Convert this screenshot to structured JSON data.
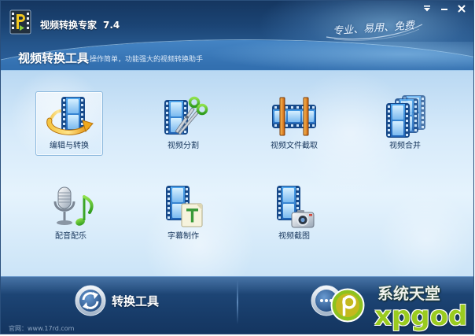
{
  "window": {
    "title": "视频转换专家",
    "version": "7.4",
    "slogan": "专业、易用、免费",
    "app_icon": "app-logo-icon",
    "controls": [
      {
        "name": "menu-dropdown-icon"
      },
      {
        "name": "minimize-icon"
      },
      {
        "name": "close-icon"
      }
    ]
  },
  "header": {
    "section_title": "视频转换工具",
    "section_subtitle": "操作简单，功能强大的视频转换助手"
  },
  "tools": [
    {
      "label": "编辑与转换",
      "icon": "film-convert-icon",
      "selected": true
    },
    {
      "label": "视频分割",
      "icon": "film-scissors-icon",
      "selected": false
    },
    {
      "label": "视频文件截取",
      "icon": "film-trim-icon",
      "selected": false
    },
    {
      "label": "视频合并",
      "icon": "film-merge-icon",
      "selected": false
    },
    {
      "label": "配音配乐",
      "icon": "microphone-music-icon",
      "selected": false
    },
    {
      "label": "字幕制作",
      "icon": "film-subtitle-icon",
      "selected": false
    },
    {
      "label": "视频截图",
      "icon": "film-camera-icon",
      "selected": false
    }
  ],
  "bottom_bar": {
    "convert_tab": {
      "label": "转换工具",
      "icon": "convert-arrows-icon"
    },
    "second_tab": {
      "icon": "tools-circle-icon"
    }
  },
  "footer": {
    "website": "官网：www.17rd.com"
  },
  "watermark": {
    "brand_cn": "系统天堂",
    "brand_en": "xpgod"
  },
  "colors": {
    "header_dark": "#153660",
    "panel_light": "#e5f3fd",
    "bottom_dark": "#173b68",
    "label_text": "#17365c",
    "selection_border": "#8db9de",
    "watermark_green": "#9acb20"
  }
}
